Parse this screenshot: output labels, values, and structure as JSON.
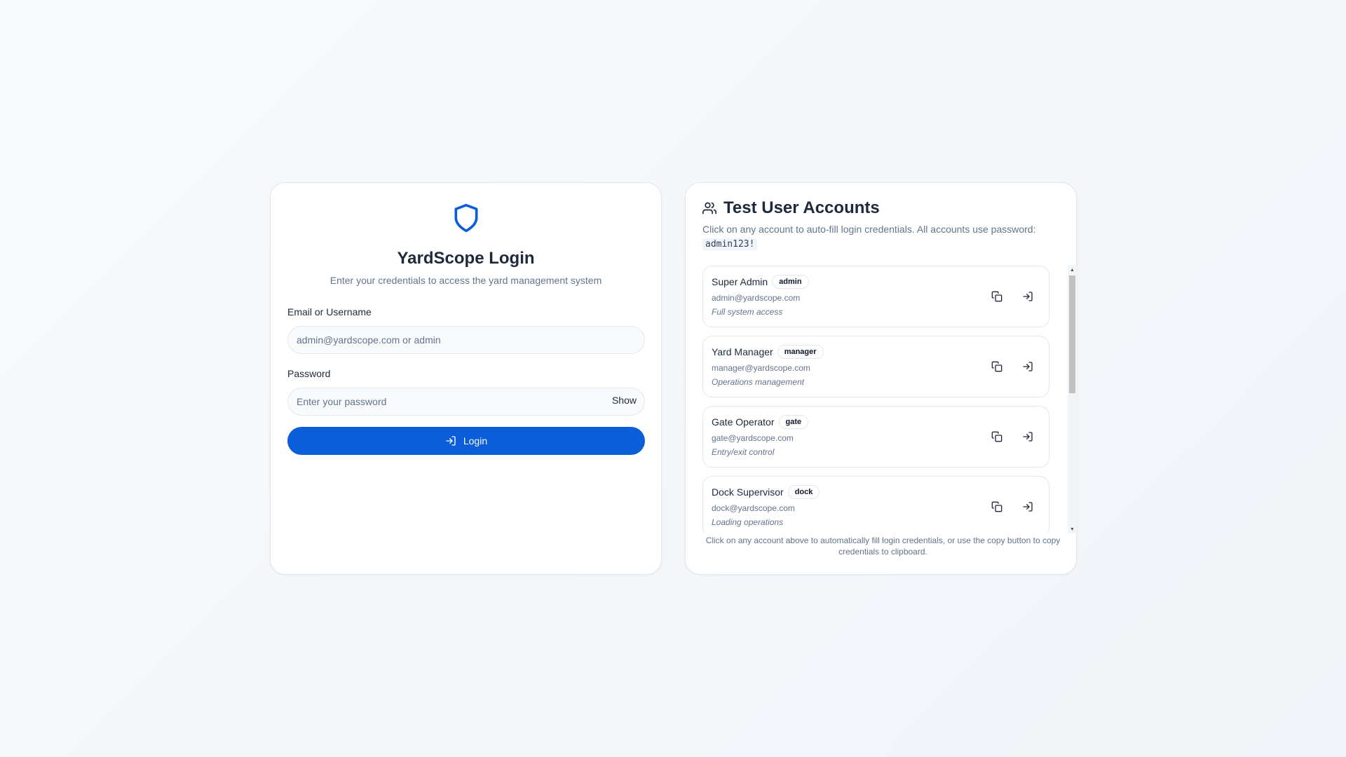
{
  "login": {
    "title": "YardScope Login",
    "subtitle": "Enter your credentials to access the yard management system",
    "email_label": "Email or Username",
    "email_placeholder": "admin@yardscope.com or admin",
    "email_value": "",
    "password_label": "Password",
    "password_placeholder": "Enter your password",
    "password_value": "",
    "show_label": "Show",
    "login_button_label": "Login",
    "icons": {
      "logo": "shield-icon",
      "login": "log-in-icon"
    },
    "accent_color": "#0b5ed7"
  },
  "accounts": {
    "title": "Test User Accounts",
    "description_text": "Click on any account to auto-fill login credentials. All accounts use password:",
    "password_code": "admin123!",
    "footer": "Click on any account above to automatically fill login credentials, or use the copy button to copy credentials to clipboard.",
    "icons": {
      "header": "users-icon",
      "copy": "copy-icon",
      "login": "log-in-icon"
    },
    "items": [
      {
        "name": "Super Admin",
        "role": "admin",
        "email": "admin@yardscope.com",
        "description": "Full system access"
      },
      {
        "name": "Yard Manager",
        "role": "manager",
        "email": "manager@yardscope.com",
        "description": "Operations management"
      },
      {
        "name": "Gate Operator",
        "role": "gate",
        "email": "gate@yardscope.com",
        "description": "Entry/exit control"
      },
      {
        "name": "Dock Supervisor",
        "role": "dock",
        "email": "dock@yardscope.com",
        "description": "Loading operations"
      }
    ]
  }
}
